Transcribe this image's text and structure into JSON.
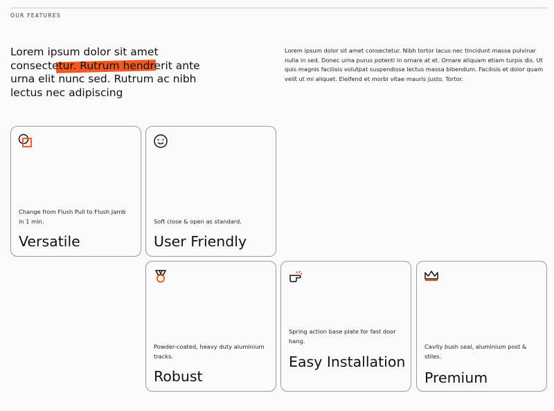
{
  "section": {
    "eyebrow": "OUR FEATURES"
  },
  "headline": {
    "part1": "Lorem ipsum dolor sit amet consecte",
    "highlight": "tur. Rutrum hendr",
    "part2": "erit ante urna elit nunc sed. Rutrum ac nibh lectus nec adipiscing"
  },
  "intro": "Lorem ipsum dolor sit amet consectetur. Nibh tortor lacus nec tincidunt massa pulvinar nulla in sed. Donec urna purus potenti in ornare at et. Ornare aliquam etiam turpis dis. Ut quis magnis facilisis volutpat suspendisse lectus massa bibendum. Facilisis et dolor quam velit ut mi aliquet. Eleifend et morbi vitae mauris justo. Tortor.",
  "colors": {
    "accent": "#f15a22",
    "border": "#9a9a9a",
    "background": "#fafafa"
  },
  "features": [
    {
      "icon": "flush-switch-icon",
      "desc": "Change from Flush Pull to Flush Jamb in 1 min.",
      "title": "Versatile"
    },
    {
      "icon": "smile-face-icon",
      "desc": "Soft close & open as standard.",
      "title": "User Friendly"
    },
    {
      "icon": "medal-icon",
      "desc": "Powder-coated, heavy duty aluminium tracks.",
      "title": "Robust"
    },
    {
      "icon": "pointing-hand-icon",
      "desc": "Spring action base plate for fast door hang.",
      "title": "Easy Installation"
    },
    {
      "icon": "crown-icon",
      "desc": "Cavity bush seal, aluminium post & stiles.",
      "title": "Premium"
    }
  ]
}
